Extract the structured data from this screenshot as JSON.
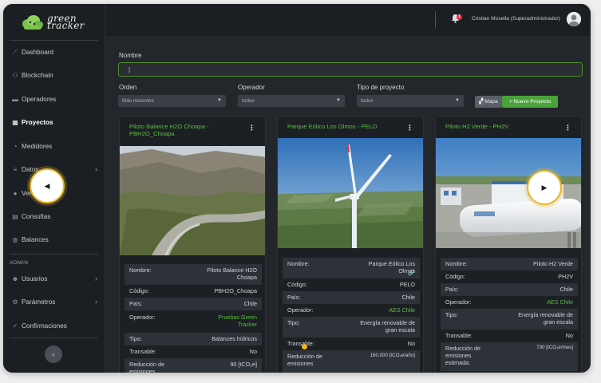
{
  "app": {
    "logo_line1": "green",
    "logo_line2": "tracker"
  },
  "sidebar": {
    "items": [
      {
        "label": "Dashboard",
        "icon": "chart-line-icon"
      },
      {
        "label": "Blockchain",
        "icon": "blockchain-icon"
      },
      {
        "label": "Operadores",
        "icon": "folder-icon"
      },
      {
        "label": "Proyectos",
        "icon": "projects-icon",
        "active": true
      },
      {
        "label": "Medidores",
        "icon": "gauge-icon"
      },
      {
        "label": "Datos",
        "icon": "database-icon"
      },
      {
        "label": "Ver",
        "icon": "eye-icon"
      },
      {
        "label": "Consultas",
        "icon": "table-icon"
      },
      {
        "label": "Balances",
        "icon": "globe-icon"
      }
    ],
    "admin_label": "ADMIN",
    "admin_items": [
      {
        "label": "Usuarios",
        "icon": "users-icon"
      },
      {
        "label": "Parámetros",
        "icon": "sliders-icon"
      },
      {
        "label": "Confirmaciones",
        "icon": "check-icon"
      }
    ]
  },
  "topbar": {
    "notification_count": "1",
    "user_name": "Cristian Mosella (Superadministrador)"
  },
  "filters": {
    "name_label": "Nombre",
    "name_value": "|",
    "order_label": "Orden",
    "order_value": "Más recientes",
    "operator_label": "Operador",
    "operator_value": "todos",
    "type_label": "Tipo de proyecto",
    "type_value": "todos",
    "map_button": "Mapa",
    "new_button": "+ Nuevo Proyecto"
  },
  "cards": [
    {
      "title": "Piloto Balance H2O Choapa - PBH2O_Choapa",
      "rows": [
        {
          "k": "Nombre:",
          "v": "Piloto Balance H2O Choapa"
        },
        {
          "k": "Código:",
          "v": "PBH2O_Choapa"
        },
        {
          "k": "País:",
          "v": "Chile"
        },
        {
          "k": "Operador:",
          "v": "Pruebas Green Tracker"
        },
        {
          "k": "Tipo:",
          "v": "Balances hídricos"
        },
        {
          "k": "Transable:",
          "v": "No"
        },
        {
          "k": "Reducción de emisiones",
          "v": "90 [tCO₂e]"
        }
      ]
    },
    {
      "title": "Parque Eólico Los Olmos - PELO",
      "rows": [
        {
          "k": "Nombre:",
          "v": "Parque Eólico Los Olmos"
        },
        {
          "k": "Código:",
          "v": "PELO"
        },
        {
          "k": "País:",
          "v": "Chile"
        },
        {
          "k": "Operador:",
          "v": "AES Chile"
        },
        {
          "k": "Tipo:",
          "v": "Energía renovable de gran escala"
        },
        {
          "k": "Transable:",
          "v": "No"
        },
        {
          "k": "Reducción de emisiones",
          "v": "160.000 [tCO₂e/año]"
        }
      ]
    },
    {
      "title": "Piloto H2 Verde - PH2V",
      "rows": [
        {
          "k": "Nombre:",
          "v": "Piloto H2 Verde"
        },
        {
          "k": "Código:",
          "v": "PH2V"
        },
        {
          "k": "País:",
          "v": "Chile"
        },
        {
          "k": "Operador:",
          "v": "AES Chile"
        },
        {
          "k": "Tipo:",
          "v": "Energía renovable de gran escala"
        },
        {
          "k": "Transable:",
          "v": "No"
        },
        {
          "k": "Reducción de emisiones estimada:",
          "v": "730 [tCO₂e/mes]"
        }
      ]
    }
  ],
  "colors": {
    "accent_green": "#5bbf45",
    "button_green": "#4aa33a",
    "sidebar_bg": "#1b1e22",
    "highlight_yellow": "#e8b52a"
  }
}
